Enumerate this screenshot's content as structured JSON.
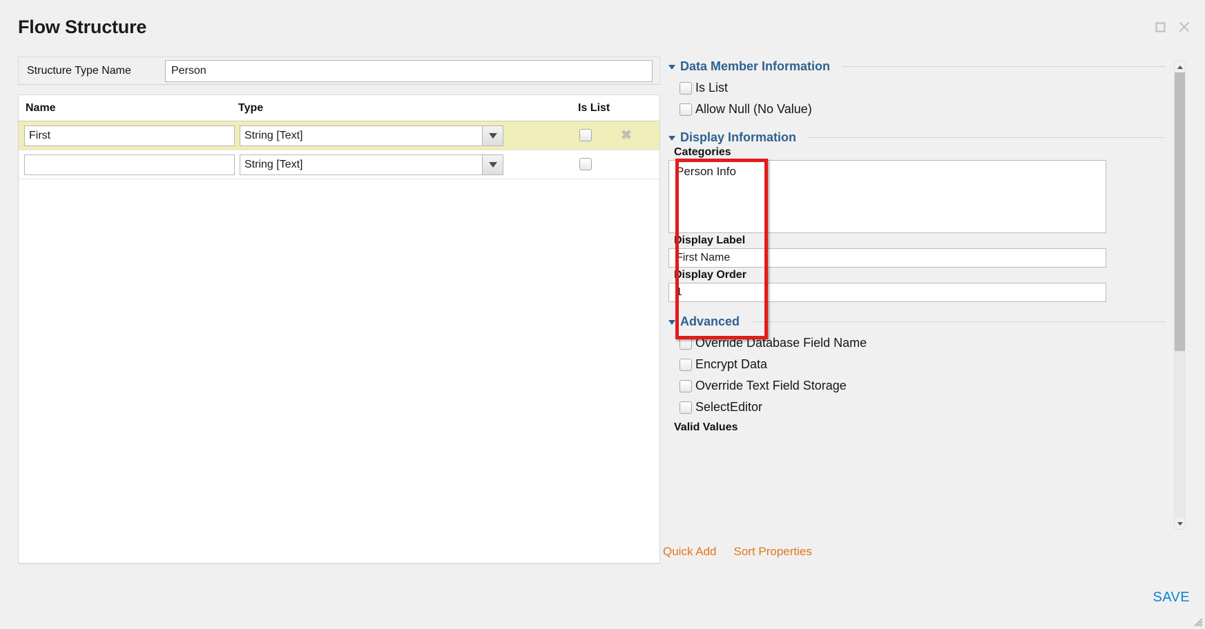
{
  "window": {
    "title": "Flow Structure",
    "maximize_icon": "maximize-icon",
    "close_icon": "close-icon"
  },
  "structure": {
    "type_name_label": "Structure Type Name",
    "type_name_value": "Person"
  },
  "members_table": {
    "columns": [
      "Name",
      "Type",
      "Is List"
    ],
    "rows": [
      {
        "name": "First",
        "type": "String [Text]",
        "is_list": false,
        "selected": true,
        "delete_glyph": "✖"
      },
      {
        "name": "",
        "type": "String [Text]",
        "is_list": false,
        "selected": false,
        "delete_glyph": ""
      }
    ]
  },
  "data_member_information": {
    "header": "Data Member Information",
    "checkboxes": [
      {
        "label": "Is List",
        "checked": false
      },
      {
        "label": "Allow Null (No Value)",
        "checked": false
      }
    ]
  },
  "display_information": {
    "header": "Display Information",
    "categories_label": "Categories",
    "categories_options": [
      "Person Info"
    ],
    "display_label_label": "Display Label",
    "display_label_value": "First Name",
    "display_order_label": "Display Order",
    "display_order_value": "1"
  },
  "advanced": {
    "header": "Advanced",
    "checkboxes": [
      {
        "label": "Override Database Field Name",
        "checked": false
      },
      {
        "label": "Encrypt Data",
        "checked": false
      },
      {
        "label": "Override Text Field Storage",
        "checked": false
      },
      {
        "label": "SelectEditor",
        "checked": false
      }
    ],
    "valid_values_label": "Valid Values"
  },
  "footer": {
    "quick_add": "Quick Add",
    "sort_properties": "Sort Properties",
    "save": "SAVE"
  },
  "colors": {
    "section_header": "#2f6191",
    "link_orange": "#e2761b",
    "save_blue": "#0f83d4",
    "selected_row": "#efeeb8",
    "annotation_red": "#e21b1b"
  }
}
